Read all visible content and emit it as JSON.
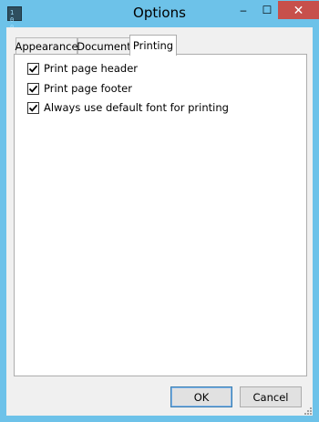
{
  "window": {
    "title": "Options",
    "app_icon_text": "1 0 0 1",
    "controls": {
      "minimize": "–",
      "maximize": "☐",
      "close": "✕"
    }
  },
  "tabs": [
    {
      "label": "Appearance",
      "active": false
    },
    {
      "label": "Document",
      "active": false
    },
    {
      "label": "Printing",
      "active": true
    }
  ],
  "printing": {
    "options": [
      {
        "label": "Print page header",
        "checked": true
      },
      {
        "label": "Print page footer",
        "checked": true
      },
      {
        "label": "Always use default font for printing",
        "checked": true
      }
    ]
  },
  "buttons": {
    "ok": "OK",
    "cancel": "Cancel"
  },
  "colors": {
    "frame": "#6dc2e9",
    "close_button": "#c7504b",
    "dialog_bg": "#f0f0f0",
    "panel_bg": "#ffffff"
  }
}
